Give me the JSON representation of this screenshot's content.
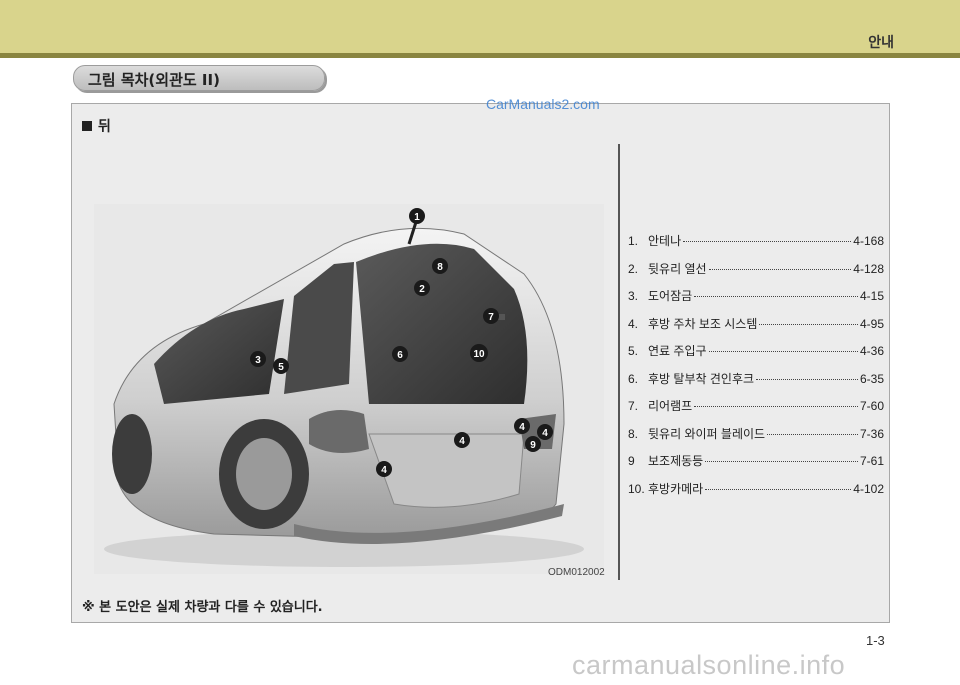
{
  "header": {
    "chapter_title": "안내"
  },
  "section_title": "그림 목차(외관도 II)",
  "view_label": "뒤",
  "watermark_text": "CarManuals2.com",
  "figure": {
    "code": "ODM012002",
    "callouts": [
      "1",
      "2",
      "3",
      "4",
      "4",
      "4",
      "4",
      "5",
      "6",
      "7",
      "8",
      "9",
      "10"
    ]
  },
  "index_items": [
    {
      "num": "1.",
      "name": "안테나",
      "page": "4-168"
    },
    {
      "num": "2.",
      "name": "뒷유리 열선",
      "page": "4-128"
    },
    {
      "num": "3.",
      "name": "도어잠금",
      "page": "4-15"
    },
    {
      "num": "4.",
      "name": "후방 주차 보조 시스템",
      "page": "4-95"
    },
    {
      "num": "5.",
      "name": "연료 주입구",
      "page": "4-36"
    },
    {
      "num": "6.",
      "name": "후방 탈부착 견인후크",
      "page": "6-35"
    },
    {
      "num": "7.",
      "name": "리어램프",
      "page": "7-60"
    },
    {
      "num": "8.",
      "name": "뒷유리 와이퍼 블레이드",
      "page": "7-36"
    },
    {
      "num": "9",
      "name": "보조제동등",
      "page": "7-61"
    },
    {
      "num": "10.",
      "name": "후방카메라",
      "page": "4-102"
    }
  ],
  "footnote": "※ 본 도안은 실제 차량과 다를 수 있습니다.",
  "page_number": "1-3",
  "site_watermark": "carmanualsonline.info",
  "colors": {
    "header_band": "#d9d48c",
    "header_rule": "#8a8540",
    "panel_bg": "#ececec",
    "callout": "#1a1a1a",
    "watermark_blue": "#3a7fd0"
  }
}
